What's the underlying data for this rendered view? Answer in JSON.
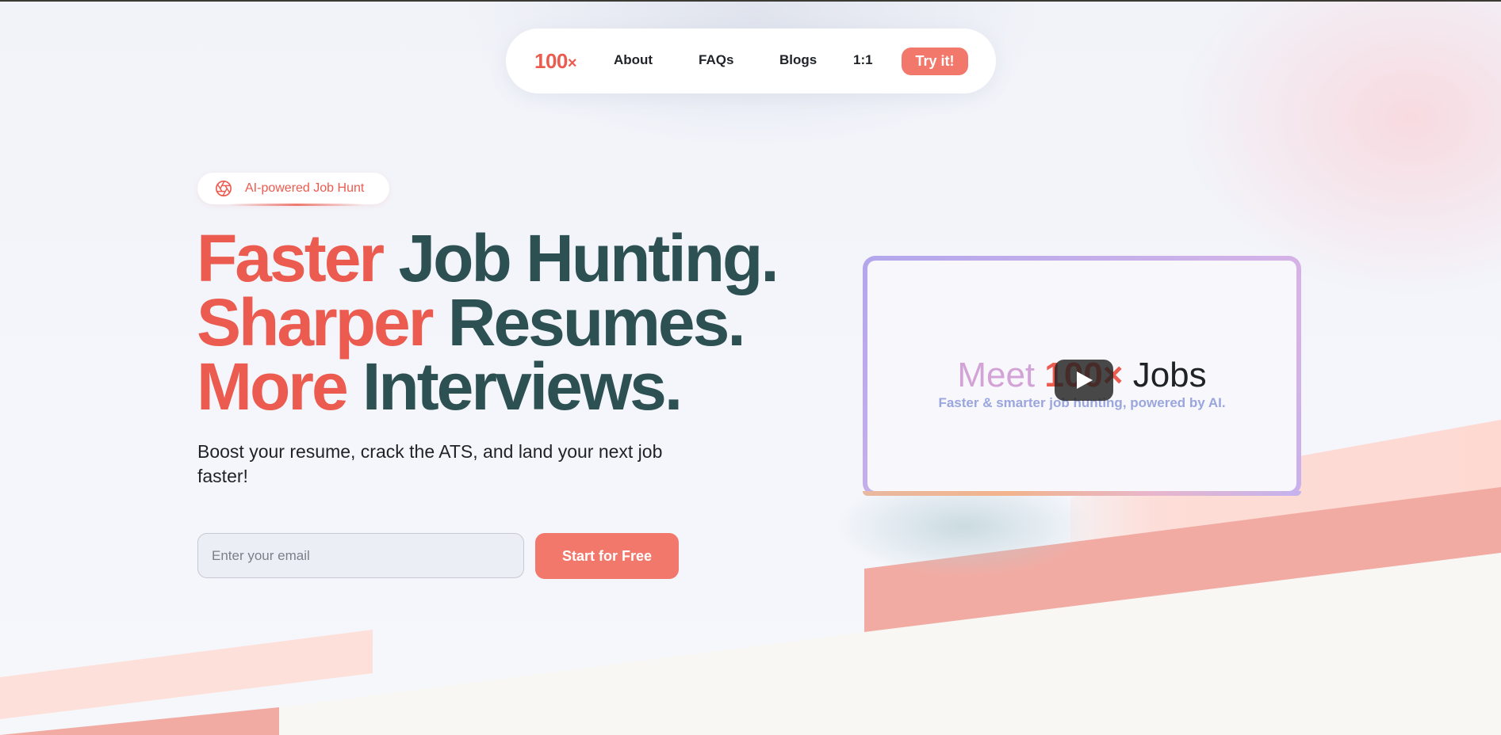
{
  "nav": {
    "logo": {
      "text": "100",
      "mark": "×"
    },
    "links": [
      "About",
      "FAQs",
      "Blogs",
      "1:1"
    ],
    "cta": "Try it!"
  },
  "hero": {
    "badge": {
      "icon": "aperture-icon",
      "text": "AI-powered Job Hunt"
    },
    "headline": [
      {
        "accent": "Faster",
        "rest": " Job Hunting."
      },
      {
        "accent": "Sharper",
        "rest": " Resumes."
      },
      {
        "accent": "More",
        "rest": " Interviews."
      }
    ],
    "subtitle": "Boost your resume, crack the ATS, and land your next job faster!",
    "email": {
      "placeholder": "Enter your email",
      "value": ""
    },
    "cta": "Start for Free"
  },
  "video": {
    "title_meet": "Meet ",
    "title_brand": "100×",
    "title_jobs": " Jobs",
    "subtitle": "Faster & smarter job hunting, powered by AI.",
    "play_icon": "play-icon"
  },
  "colors": {
    "accent": "#ec5b4f",
    "button": "#f2786b",
    "heading": "#2d5053",
    "text": "#1f2328"
  }
}
